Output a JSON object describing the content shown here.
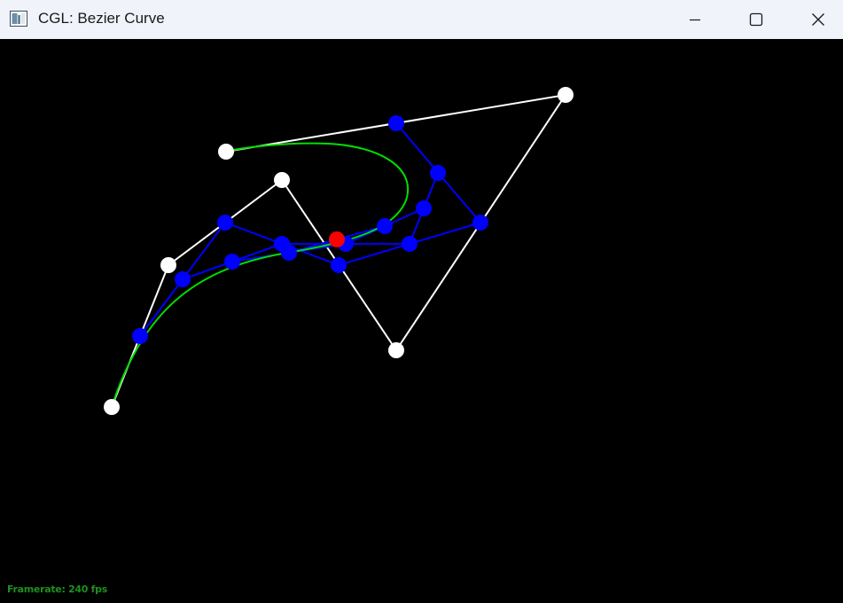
{
  "window": {
    "title": "CGL: Bezier Curve"
  },
  "icons": {
    "app": "app-window-icon",
    "minimize": "minimize-icon",
    "maximize": "maximize-icon",
    "close": "close-icon"
  },
  "status": {
    "framerate": "Framerate: 240 fps"
  },
  "colors": {
    "background": "#000000",
    "control_polygon": "#ffffff",
    "intermediate": "#0000ff",
    "curve": "#00dd00",
    "evaluated_point": "#ff0000"
  }
}
